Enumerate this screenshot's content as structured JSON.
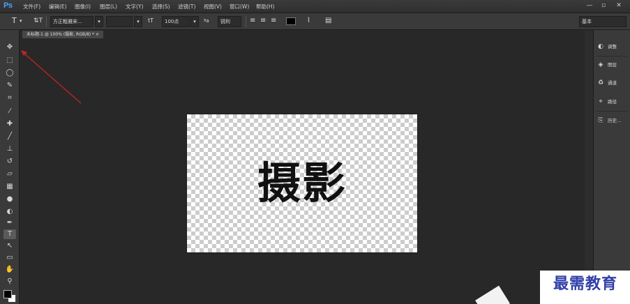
{
  "app": {
    "logo": "Ps"
  },
  "menu": [
    "文件(F)",
    "编辑(E)",
    "图像(I)",
    "图层(L)",
    "文字(Y)",
    "选择(S)",
    "滤镜(T)",
    "视图(V)",
    "窗口(W)",
    "帮助(H)"
  ],
  "window_controls": {
    "minimize": "—",
    "restore": "▫",
    "close": "✕"
  },
  "options": {
    "tool_glyph": "T",
    "orient_glyph": "⇅T",
    "font_family": "方正粗雅宋...",
    "font_size": "100点",
    "aa_mode": "锐利",
    "aa_icon": "ªa",
    "size_icon": "tT",
    "warp_icon": "⌇",
    "panel_icon": "▤",
    "workspace": "基本"
  },
  "document": {
    "tab_label": "未标题-1 @ 100% (摄影, RGB/8) * ×",
    "text": "摄影"
  },
  "tools": [
    {
      "name": "move-tool",
      "glyph": "✥"
    },
    {
      "name": "marquee-tool",
      "glyph": "⬚"
    },
    {
      "name": "lasso-tool",
      "glyph": "◯"
    },
    {
      "name": "quick-select-tool",
      "glyph": "✎"
    },
    {
      "name": "crop-tool",
      "glyph": "⌗"
    },
    {
      "name": "eyedropper-tool",
      "glyph": "⁄"
    },
    {
      "name": "healing-tool",
      "glyph": "✚"
    },
    {
      "name": "brush-tool",
      "glyph": "╱"
    },
    {
      "name": "stamp-tool",
      "glyph": "⊥"
    },
    {
      "name": "history-brush-tool",
      "glyph": "↺"
    },
    {
      "name": "eraser-tool",
      "glyph": "▱"
    },
    {
      "name": "gradient-tool",
      "glyph": "▦"
    },
    {
      "name": "blur-tool",
      "glyph": "●"
    },
    {
      "name": "dodge-tool",
      "glyph": "◐"
    },
    {
      "name": "pen-tool",
      "glyph": "✒"
    },
    {
      "name": "type-tool",
      "glyph": "T"
    },
    {
      "name": "path-select-tool",
      "glyph": "↖"
    },
    {
      "name": "shape-tool",
      "glyph": "▭"
    },
    {
      "name": "hand-tool",
      "glyph": "✋"
    },
    {
      "name": "zoom-tool",
      "glyph": "⚲"
    }
  ],
  "panels": [
    {
      "icon": "◐",
      "label": "调整"
    },
    {
      "icon": "◈",
      "label": "图层"
    },
    {
      "icon": "♻",
      "label": "通道"
    },
    {
      "icon": "⌖",
      "label": "路径"
    },
    {
      "icon": "⎘",
      "label": "历史..."
    }
  ],
  "watermark": "最需教育",
  "colors": {
    "accent_blue": "#4aa3ff",
    "watermark_blue": "#2f3ea8",
    "annotation_arrow": "#cc2222"
  }
}
